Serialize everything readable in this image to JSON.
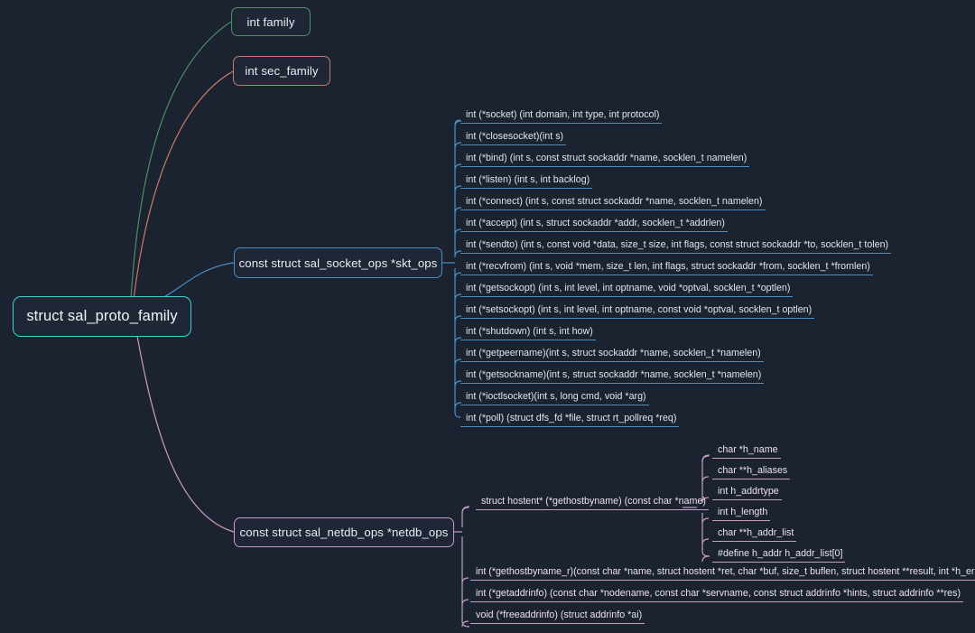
{
  "diagram": {
    "type": "mindmap",
    "title": "struct sal_proto_family",
    "background_color": "#1b2230",
    "root": {
      "label": "struct sal_proto_family",
      "color": "#3fd3cd"
    },
    "branches": [
      {
        "label": "int family",
        "color": "#4e8f63"
      },
      {
        "label": "int sec_family",
        "color": "#c8796b"
      },
      {
        "label": "const struct sal_socket_ops *skt_ops",
        "color": "#4a8fc4"
      },
      {
        "label": "const struct sal_netdb_ops *netdb_ops",
        "color": "#c79dc0"
      }
    ]
  },
  "socket_ops": {
    "color": "#4a8fc4",
    "items": [
      "int (*socket)      (int domain, int type, int protocol)",
      "int (*closesocket)(int s)",
      "int (*bind)        (int s, const struct sockaddr *name, socklen_t namelen)",
      "int (*listen)     (int s, int backlog)",
      "int (*connect)    (int s, const struct sockaddr *name, socklen_t namelen)",
      "int (*accept)     (int s, struct sockaddr *addr, socklen_t *addrlen)",
      "int (*sendto)     (int s, const void *data, size_t size, int flags, const struct sockaddr *to, socklen_t tolen)",
      "int (*recvfrom)   (int s, void *mem, size_t len, int flags, struct sockaddr *from, socklen_t *fromlen)",
      "int (*getsockopt) (int s, int level, int optname, void *optval, socklen_t *optlen)",
      "int (*setsockopt) (int s, int level, int optname, const void *optval, socklen_t optlen)",
      "int (*shutdown)   (int s, int how)",
      "int (*getpeername)(int s, struct sockaddr *name, socklen_t *namelen)",
      "int (*getsockname)(int s, struct sockaddr *name, socklen_t *namelen)",
      "int (*ioctlsocket)(int s, long cmd, void *arg)",
      "int (*poll)       (struct dfs_fd *file, struct rt_pollreq *req)"
    ]
  },
  "netdb_ops": {
    "color": "#c79dc0",
    "items": [
      "struct hostent* (*gethostbyname)  (const char *name)",
      "int  (*gethostbyname_r)(const char *name, struct hostent *ret, char *buf, size_t buflen, struct hostent **result, int *h_errnop)",
      "int  (*getaddrinfo)    (const char *nodename, const char *servname, const struct addrinfo *hints, struct addrinfo **res)",
      "void  (*freeaddrinfo)   (struct addrinfo *ai)"
    ]
  },
  "hostent_fields": {
    "color": "#c79dc0",
    "items": [
      "char  *h_name",
      "char **h_aliases",
      "int    h_addrtype",
      "int    h_length",
      "char **h_addr_list",
      "#define h_addr h_addr_list[0]"
    ]
  }
}
